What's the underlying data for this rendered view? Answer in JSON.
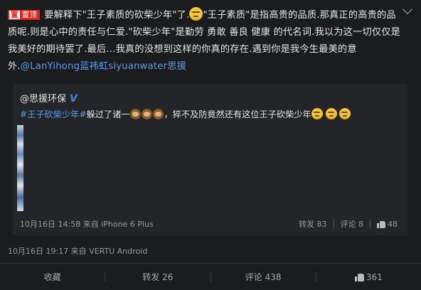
{
  "post": {
    "pin_badge": {
      "box": "置",
      "text": "置顶"
    },
    "text_1": "要解释下\"王子素质的砍柴少年\"了.",
    "text_2": "\"王子素质\"是指高贵的品质.那真正的高贵的品质呢.则是心中的责任与仁爱.\"砍柴少年\"是勤劳 勇敢 善良 健康 的代名词.我以为这一切仅仅是我美好的期待罢了.最后…我真的没想到这样的你真的存在.遇到你是我今生最美的意外.",
    "mention": "@LanYihong蓝袆虹siyuanwater思援",
    "timestamp": "10月16日 19:17 来自 VERTU Android"
  },
  "quote": {
    "author": "@思援环保",
    "verified_mark": "V",
    "hashtag": "#王子砍柴少年#",
    "text_1": "躲过了诸一",
    "text_2": "，猝不及防竟然还有这位王子砍柴少年",
    "timestamp": "10月16日 14:58 来自 iPhone 6 Plus",
    "repost": "转发 83",
    "comment": "评论 8",
    "likes": "48"
  },
  "actions": {
    "favorite": "收藏",
    "repost": "转发 26",
    "comment": "评论 438",
    "likes": "361"
  },
  "icons": [
    "chevron-down-icon",
    "grin-emoji-icon",
    "see-no-evil-monkey-icon",
    "smirk-emoji-icon",
    "verified-icon",
    "thumbs-up-icon"
  ]
}
